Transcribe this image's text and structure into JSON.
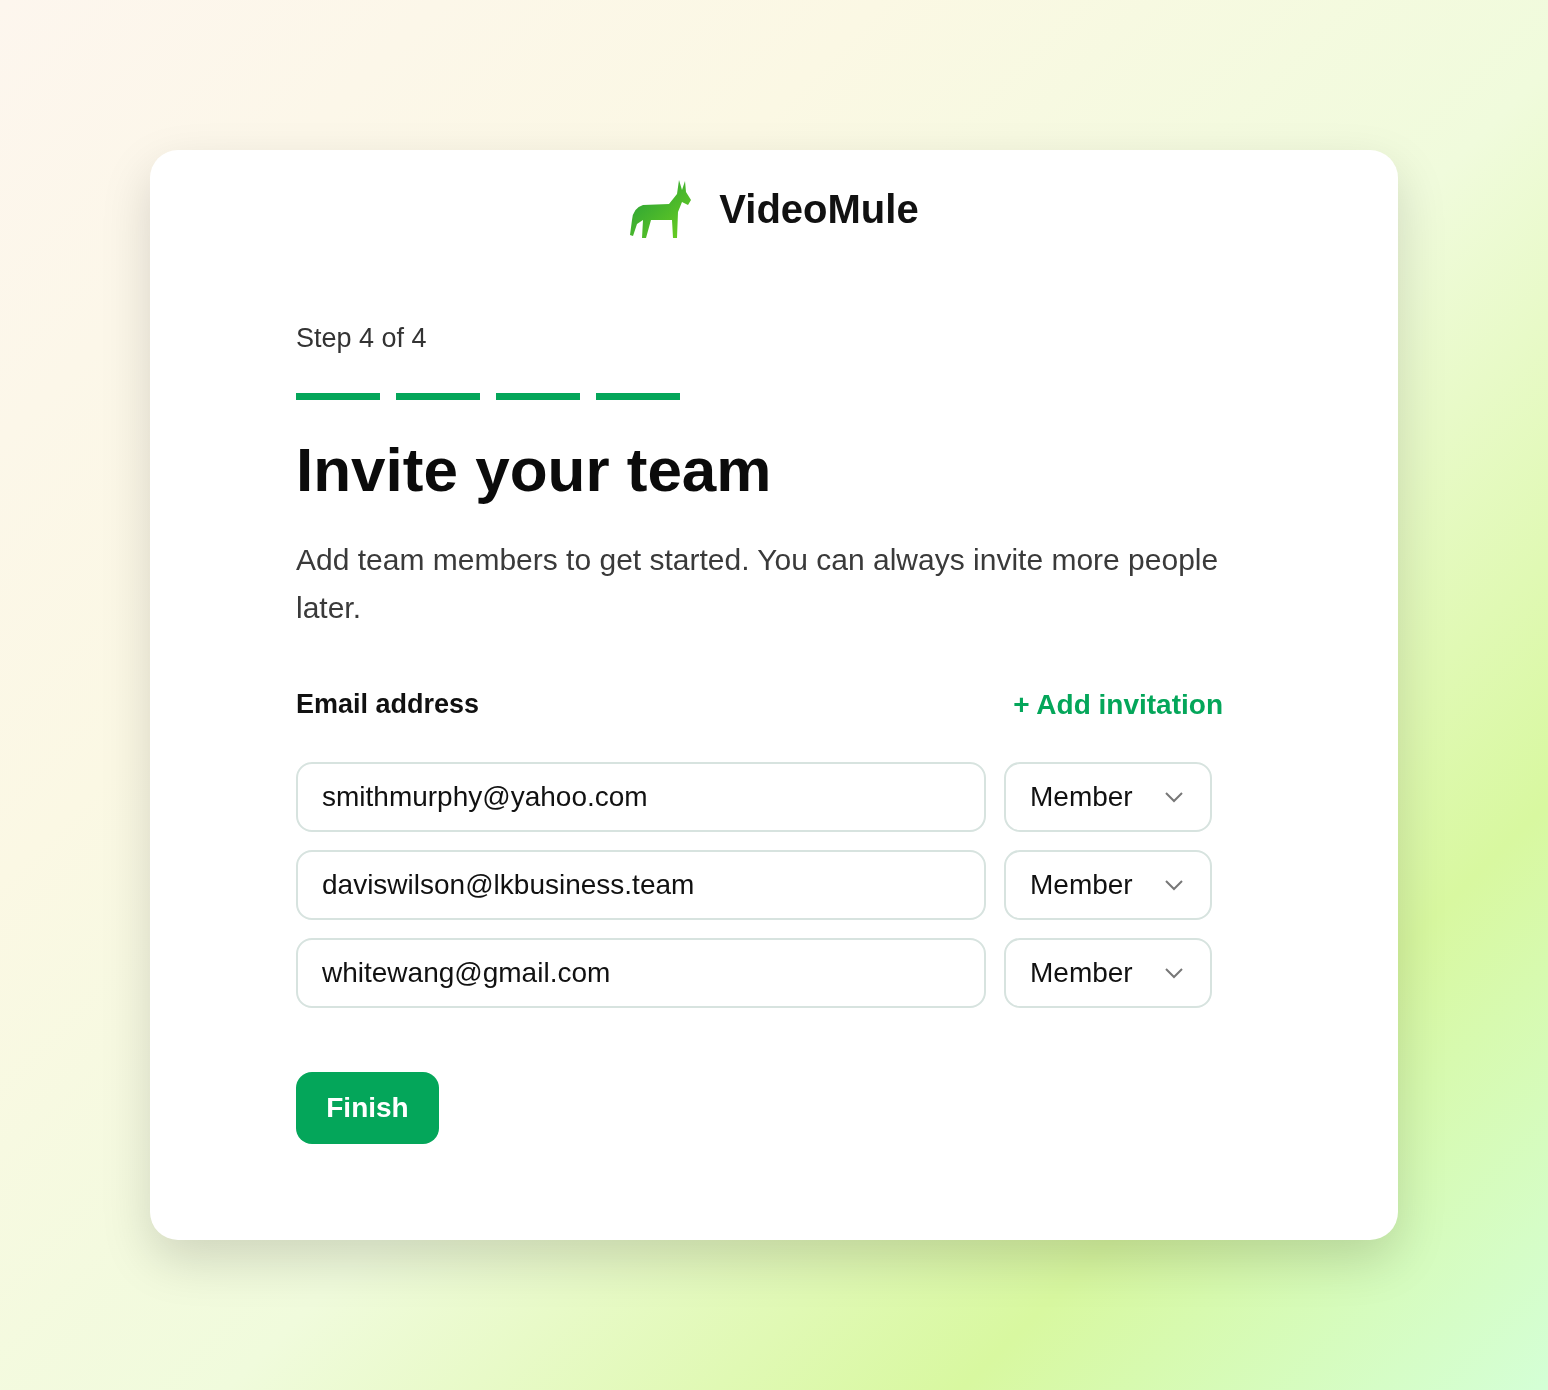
{
  "brand": {
    "name": "VideoMule"
  },
  "step": {
    "label": "Step 4 of 4",
    "segments": [
      {
        "done": true
      },
      {
        "done": true
      },
      {
        "done": true
      },
      {
        "done": true
      }
    ]
  },
  "title": "Invite your team",
  "description": "Add team members to get started. You can always invite more people later.",
  "email_label": "Email address",
  "add_link": "+ Add invitation",
  "invitations": [
    {
      "email": "smithmurphy@yahoo.com",
      "role": "Member"
    },
    {
      "email": "daviswilson@lkbusiness.team",
      "role": "Member"
    },
    {
      "email": "whitewang@gmail.com",
      "role": "Member"
    }
  ],
  "finish_button": "Finish"
}
